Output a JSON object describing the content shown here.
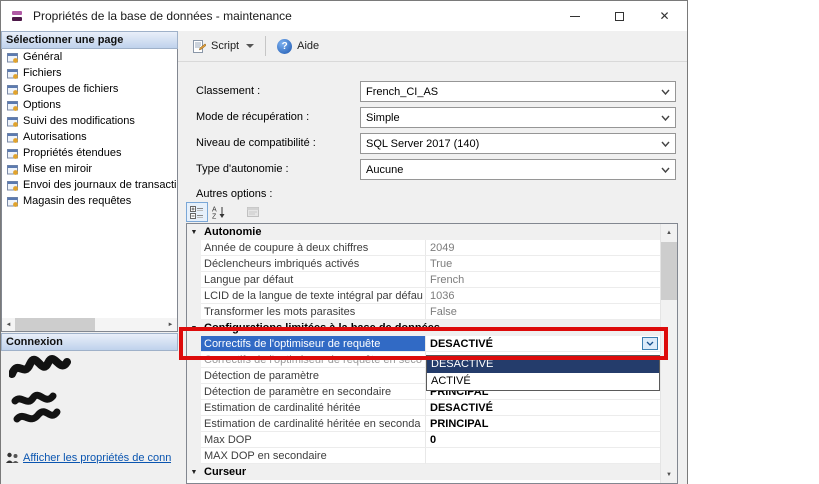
{
  "window": {
    "title": "Propriétés de la base de données - maintenance"
  },
  "icons": {
    "close_glyph": "✕",
    "help_glyph": "?",
    "category_expanded_glyph": "▼",
    "scroll_left_glyph": "◄",
    "scroll_right_glyph": "►",
    "scroll_up_glyph": "▲",
    "scroll_down_glyph": "▼"
  },
  "colors": {
    "selection_blue": "#316ac5",
    "dropdown_highlight_navy": "#243c6b",
    "annotation_red": "#dd0b0b",
    "link_blue": "#0a55b0",
    "panel_header_blue": "#bfd2ec"
  },
  "sidebar": {
    "page_header": "Sélectionner une page",
    "items": [
      {
        "label": "Général"
      },
      {
        "label": "Fichiers"
      },
      {
        "label": "Groupes de fichiers"
      },
      {
        "label": "Options"
      },
      {
        "label": "Suivi des modifications"
      },
      {
        "label": "Autorisations"
      },
      {
        "label": "Propriétés étendues"
      },
      {
        "label": "Mise en miroir"
      },
      {
        "label": "Envoi des journaux de transacti"
      },
      {
        "label": "Magasin des requêtes"
      }
    ],
    "connection_header": "Connexion",
    "connection_link": "Afficher les propriétés de conn"
  },
  "toolbar": {
    "script_label": "Script",
    "help_label": "Aide"
  },
  "form": {
    "fields": [
      {
        "label": "Classement :",
        "value": "French_CI_AS"
      },
      {
        "label": "Mode de récupération :",
        "value": "Simple"
      },
      {
        "label": "Niveau de compatibilité :",
        "value": "SQL Server 2017 (140)"
      },
      {
        "label": "Type d'autonomie :",
        "value": "Aucune"
      }
    ],
    "other_options_label": "Autres options :"
  },
  "grid": {
    "rows": [
      {
        "type": "category",
        "name": "Autonomie",
        "value": ""
      },
      {
        "type": "property",
        "name": "Année de coupure à deux chiffres",
        "value": "2049"
      },
      {
        "type": "property",
        "name": "Déclencheurs imbriqués activés",
        "value": "True"
      },
      {
        "type": "property",
        "name": "Langue par défaut",
        "value": "French"
      },
      {
        "type": "property",
        "name": "LCID de la langue de texte intégral par défau",
        "value": "1036"
      },
      {
        "type": "property",
        "name": "Transformer les mots parasites",
        "value": "False"
      },
      {
        "type": "category",
        "name": "Configurations limitées à la base de données",
        "value": ""
      },
      {
        "type": "property",
        "name": "Correctifs de l'optimiseur de requête",
        "value": "DESACTIVÉ",
        "selected": true
      },
      {
        "type": "property",
        "name": "Correctifs de l'optimiseur de requête en seco",
        "value": ""
      },
      {
        "type": "property",
        "name": "Détection de paramètre",
        "value": ""
      },
      {
        "type": "property",
        "name": "Détection de paramètre en secondaire",
        "value": "PRINCIPAL"
      },
      {
        "type": "property",
        "name": "Estimation de cardinalité héritée",
        "value": "DESACTIVÉ"
      },
      {
        "type": "property",
        "name": "Estimation de cardinalité héritée en seconda",
        "value": "PRINCIPAL"
      },
      {
        "type": "property",
        "name": "Max DOP",
        "value": "0"
      },
      {
        "type": "property",
        "name": "MAX DOP en secondaire",
        "value": ""
      },
      {
        "type": "category",
        "name": "Curseur",
        "value": ""
      }
    ]
  },
  "dropdown": {
    "options": [
      {
        "label": "DESACTIVÉ",
        "selected": true
      },
      {
        "label": "ACTIVÉ",
        "selected": false
      }
    ]
  }
}
